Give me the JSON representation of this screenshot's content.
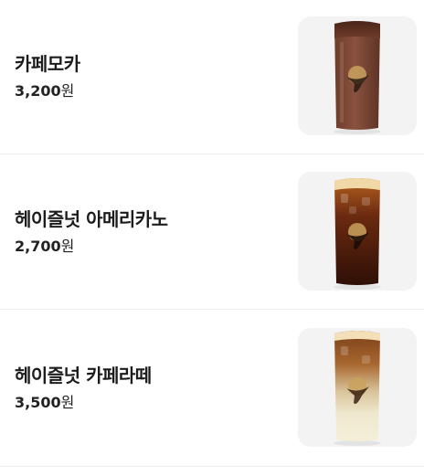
{
  "currency_unit": "원",
  "items": [
    {
      "name": "카페모카",
      "price": "3,200",
      "image": "iced-cafe-mocha-cup"
    },
    {
      "name": "헤이즐넛 아메리카노",
      "price": "2,700",
      "image": "iced-hazelnut-americano-cup"
    },
    {
      "name": "헤이즐넛 카페라떼",
      "price": "3,500",
      "image": "iced-hazelnut-latte-cup"
    }
  ]
}
